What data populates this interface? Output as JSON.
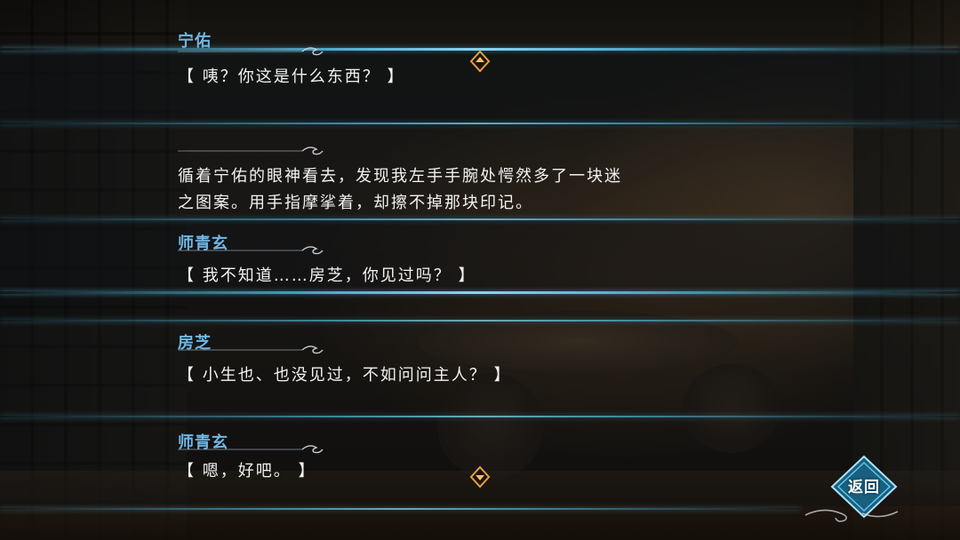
{
  "log": {
    "cut_speaker": "宁佑",
    "entries": [
      {
        "speaker": "",
        "lines": [
          "【 咦？你这是什么东西？ 】"
        ]
      },
      {
        "speaker": "",
        "lines": [
          "循着宁佑的眼神看去，发现我左手手腕处愕然多了一块迷",
          "之图案。用手指摩挲着，却擦不掉那块印记。"
        ]
      },
      {
        "speaker": "师青玄",
        "lines": [
          "【 我不知道……房芝，你见过吗？ 】"
        ]
      },
      {
        "speaker": "房芝",
        "lines": [
          "【 小生也、也没见过，不如问问主人？ 】"
        ]
      },
      {
        "speaker": "师青玄",
        "lines": [
          "【 嗯，好吧。 】"
        ]
      }
    ]
  },
  "controls": {
    "scroll_up_icon": "up-arrow-icon",
    "scroll_down_icon": "down-arrow-icon",
    "back_label": "返回"
  },
  "colors": {
    "speaker": "#6fb8e8",
    "text": "#f3f3f3",
    "accent_line": "#5ac8f0",
    "arrow": "#e8a040"
  }
}
